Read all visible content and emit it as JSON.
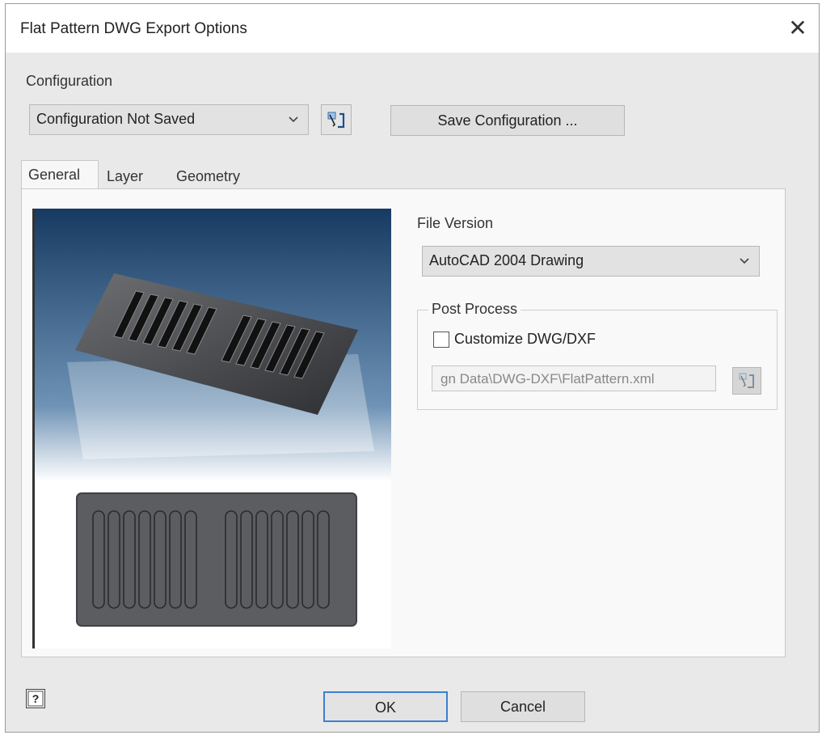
{
  "window": {
    "title": "Flat Pattern DWG Export Options",
    "close_glyph": "✕"
  },
  "configuration": {
    "label": "Configuration",
    "selected": "Configuration Not Saved",
    "browse_icon": "folder-open-icon",
    "save_button": "Save Configuration ..."
  },
  "tabs": [
    {
      "label": "General",
      "active": true
    },
    {
      "label": "Layer",
      "active": false
    },
    {
      "label": "Geometry",
      "active": false
    }
  ],
  "general": {
    "file_version_label": "File Version",
    "file_version_selected": "AutoCAD 2004 Drawing",
    "post_process": {
      "title": "Post Process",
      "customize_label": "Customize DWG/DXF",
      "customize_checked": false,
      "path_value": "gn Data\\DWG-DXF\\FlatPattern.xml",
      "browse_icon": "folder-open-icon"
    }
  },
  "footer": {
    "help_icon": "help-icon",
    "ok": "OK",
    "cancel": "Cancel"
  },
  "colors": {
    "accent_ok_border": "#3c7fd1",
    "preview_top": "#173a62",
    "preview_bottom": "#ffffff",
    "part_gray": "#5b5d60"
  }
}
